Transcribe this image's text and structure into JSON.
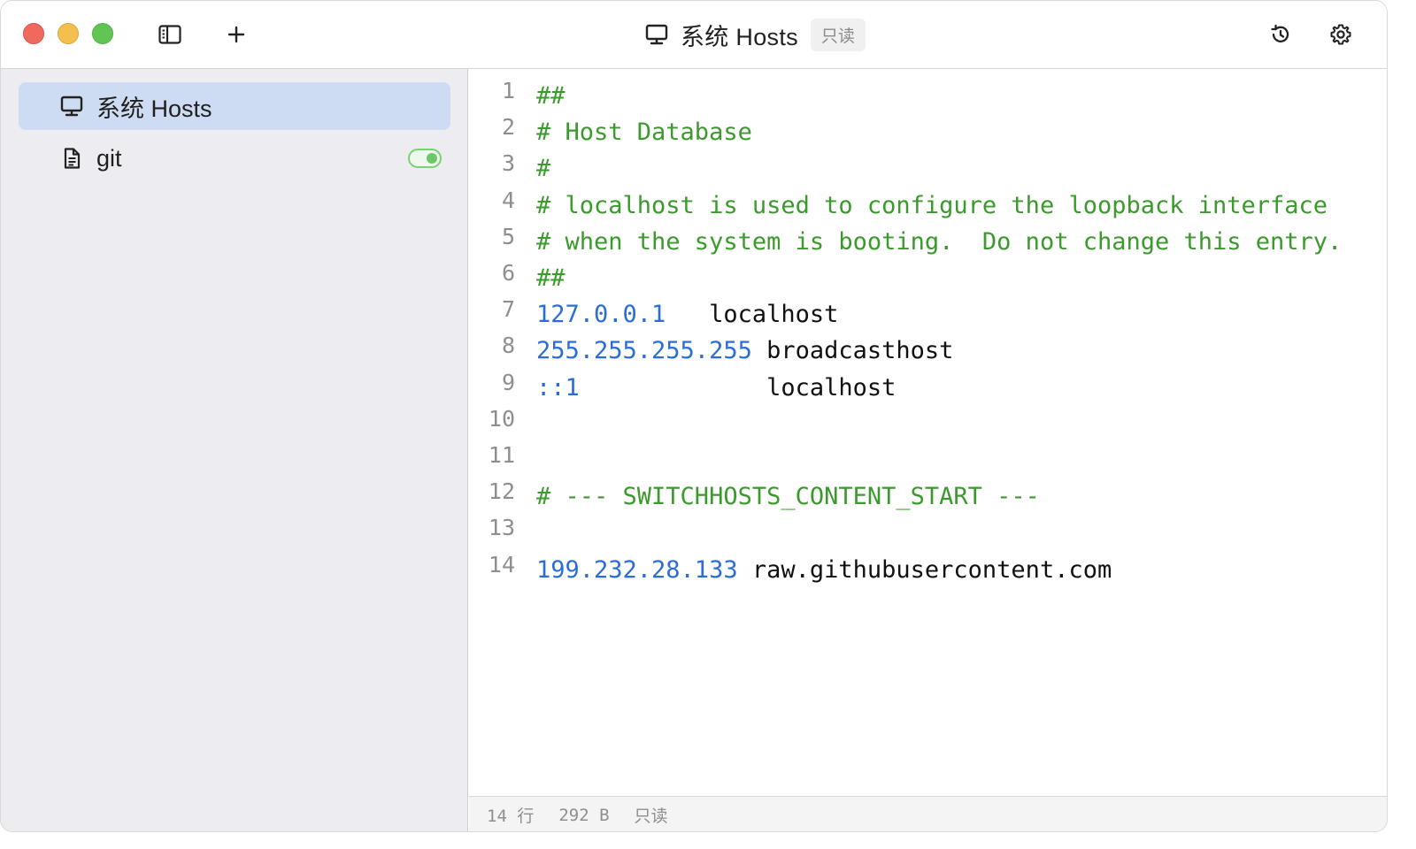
{
  "window": {
    "title": "系统 Hosts",
    "title_badge": "只读"
  },
  "toolbar": {
    "sidebar_toggle_icon": "sidebar-icon",
    "add_icon": "plus-icon",
    "history_icon": "history-icon",
    "settings_icon": "gear-icon"
  },
  "sidebar": {
    "items": [
      {
        "label": "系统 Hosts",
        "icon": "monitor-icon",
        "selected": true
      },
      {
        "label": "git",
        "icon": "file-icon",
        "toggle_on": true
      }
    ]
  },
  "editor": {
    "lines": [
      {
        "n": "1",
        "segments": [
          {
            "t": "##",
            "k": "comment"
          }
        ]
      },
      {
        "n": "2",
        "segments": [
          {
            "t": "# Host Database",
            "k": "comment"
          }
        ]
      },
      {
        "n": "3",
        "segments": [
          {
            "t": "#",
            "k": "comment"
          }
        ]
      },
      {
        "n": "4",
        "segments": [
          {
            "t": "# localhost is used to configure the loopback interface",
            "k": "comment"
          }
        ]
      },
      {
        "n": "5",
        "segments": [
          {
            "t": "# when the system is booting.  Do not change this entry.",
            "k": "comment"
          }
        ]
      },
      {
        "n": "6",
        "segments": [
          {
            "t": "##",
            "k": "comment"
          }
        ]
      },
      {
        "n": "7",
        "segments": [
          {
            "t": "127.0.0.1",
            "k": "ip"
          },
          {
            "t": "   localhost",
            "k": "host"
          }
        ]
      },
      {
        "n": "8",
        "segments": [
          {
            "t": "255.255.255.255",
            "k": "ip"
          },
          {
            "t": " broadcasthost",
            "k": "host"
          }
        ]
      },
      {
        "n": "9",
        "segments": [
          {
            "t": "::1",
            "k": "ip"
          },
          {
            "t": "             localhost",
            "k": "host"
          }
        ]
      },
      {
        "n": "10",
        "segments": []
      },
      {
        "n": "11",
        "segments": []
      },
      {
        "n": "12",
        "segments": [
          {
            "t": "# --- SWITCHHOSTS_CONTENT_START ---",
            "k": "comment"
          }
        ]
      },
      {
        "n": "13",
        "segments": []
      },
      {
        "n": "14",
        "segments": [
          {
            "t": "199.232.28.133",
            "k": "ip"
          },
          {
            "t": " raw.githubusercontent.com",
            "k": "host"
          }
        ]
      }
    ]
  },
  "statusbar": {
    "lines": "14 行",
    "size": "292 B",
    "mode": "只读"
  }
}
